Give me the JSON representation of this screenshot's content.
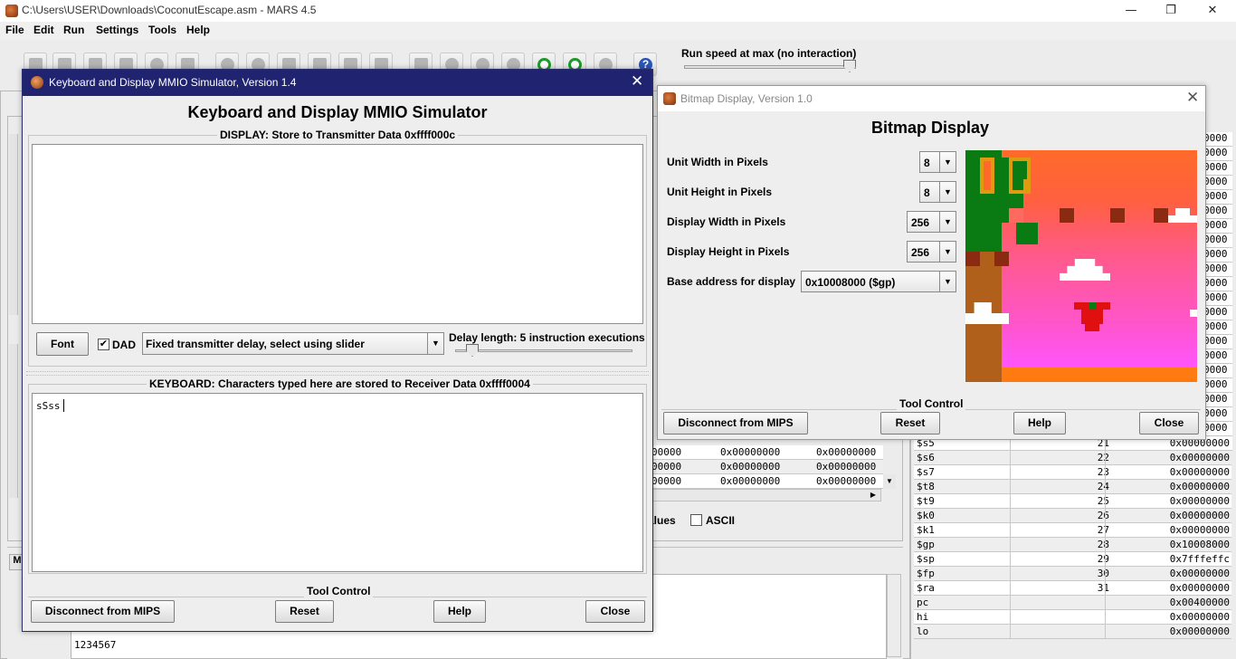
{
  "app": {
    "title": "C:\\Users\\USER\\Downloads\\CoconutEscape.asm  -  MARS 4.5",
    "minimize": "—",
    "restore": "❐",
    "close": "✕"
  },
  "menu": [
    {
      "label": "File",
      "accel": "F"
    },
    {
      "label": "Edit",
      "accel": "E"
    },
    {
      "label": "Run",
      "accel": "R"
    },
    {
      "label": "Settings",
      "accel": "S"
    },
    {
      "label": "Tools",
      "accel": "T"
    },
    {
      "label": "Help",
      "accel": "H"
    }
  ],
  "toolbar": {
    "speed_label": "Run speed at max (no interaction)",
    "help_glyph": "?"
  },
  "mmio": {
    "title": "Keyboard and Display MMIO Simulator, Version 1.4",
    "close": "✕",
    "heading": "Keyboard and Display MMIO Simulator",
    "display_group": "DISPLAY: Store to Transmitter Data 0xffff000c",
    "display_text": "",
    "font_button": "Font",
    "dad_checked": true,
    "dad_label": "DAD",
    "delay_mode": "Fixed transmitter delay, select using slider",
    "delay_label": "Delay length: 5 instruction executions",
    "delay_slider_value": 5,
    "keyboard_group": "KEYBOARD: Characters typed here are stored to Receiver Data 0xffff0004",
    "keyboard_text": "sSss",
    "tool_control": "Tool Control",
    "disconnect": "Disconnect from MIPS",
    "reset": "Reset",
    "help": "Help",
    "close_btn": "Close"
  },
  "bitmap": {
    "title": "Bitmap Display, Version 1.0",
    "close": "✕",
    "heading": "Bitmap Display",
    "unit_width_label": "Unit Width in Pixels",
    "unit_width": "8",
    "unit_height_label": "Unit Height in Pixels",
    "unit_height": "8",
    "display_width_label": "Display Width in Pixels",
    "display_width": "256",
    "display_height_label": "Display Height in Pixels",
    "display_height": "256",
    "base_address_label": "Base address for display",
    "base_address": "0x10008000 ($gp)",
    "tool_control": "Tool Control",
    "disconnect": "Disconnect from MIPS",
    "reset": "Reset",
    "help": "Help",
    "close_btn": "Close",
    "colors": {
      "sky_top": "#ff6a2a",
      "sky_bottom": "#ff55ff",
      "ground": "#ff7a10",
      "trunk": "#b0601a",
      "leaves": "#0a7a12",
      "coconut": "#e09a10",
      "dark": "#8a2a10",
      "cloud": "#ffffff",
      "enemy": "#e01010"
    }
  },
  "memory": {
    "rows": [
      {
        "a": "00000",
        "b": "0x00000000",
        "c": "0x00000000"
      },
      {
        "a": "00000",
        "b": "0x00000000",
        "c": "0x00000000"
      },
      {
        "a": "00000",
        "b": "0x00000000",
        "c": "0x00000000"
      }
    ],
    "values_label": "alues",
    "ascii_label": "ASCII"
  },
  "console": {
    "text": "1234567"
  },
  "registers": {
    "rows": [
      {
        "name": "$s5",
        "num": "21",
        "val": "0x00000000"
      },
      {
        "name": "$s6",
        "num": "22",
        "val": "0x00000000"
      },
      {
        "name": "$s7",
        "num": "23",
        "val": "0x00000000"
      },
      {
        "name": "$t8",
        "num": "24",
        "val": "0x00000000"
      },
      {
        "name": "$t9",
        "num": "25",
        "val": "0x00000000"
      },
      {
        "name": "$k0",
        "num": "26",
        "val": "0x00000000"
      },
      {
        "name": "$k1",
        "num": "27",
        "val": "0x00000000"
      },
      {
        "name": "$gp",
        "num": "28",
        "val": "0x10008000"
      },
      {
        "name": "$sp",
        "num": "29",
        "val": "0x7fffeffc"
      },
      {
        "name": "$fp",
        "num": "30",
        "val": "0x00000000"
      },
      {
        "name": "$ra",
        "num": "31",
        "val": "0x00000000"
      },
      {
        "name": "pc",
        "num": "",
        "val": "0x00400000"
      },
      {
        "name": "hi",
        "num": "",
        "val": "0x00000000"
      },
      {
        "name": "lo",
        "num": "",
        "val": "0x00000000"
      }
    ],
    "right_partial": [
      "0000",
      "0000",
      "0000",
      "0000",
      "0000",
      "0000",
      "0000",
      "0000",
      "0000",
      "0000",
      "0000",
      "0000",
      "0000",
      "0000",
      "0000",
      "0000",
      "0000",
      "0000",
      "0000",
      "0000",
      "0000",
      "0000"
    ]
  }
}
